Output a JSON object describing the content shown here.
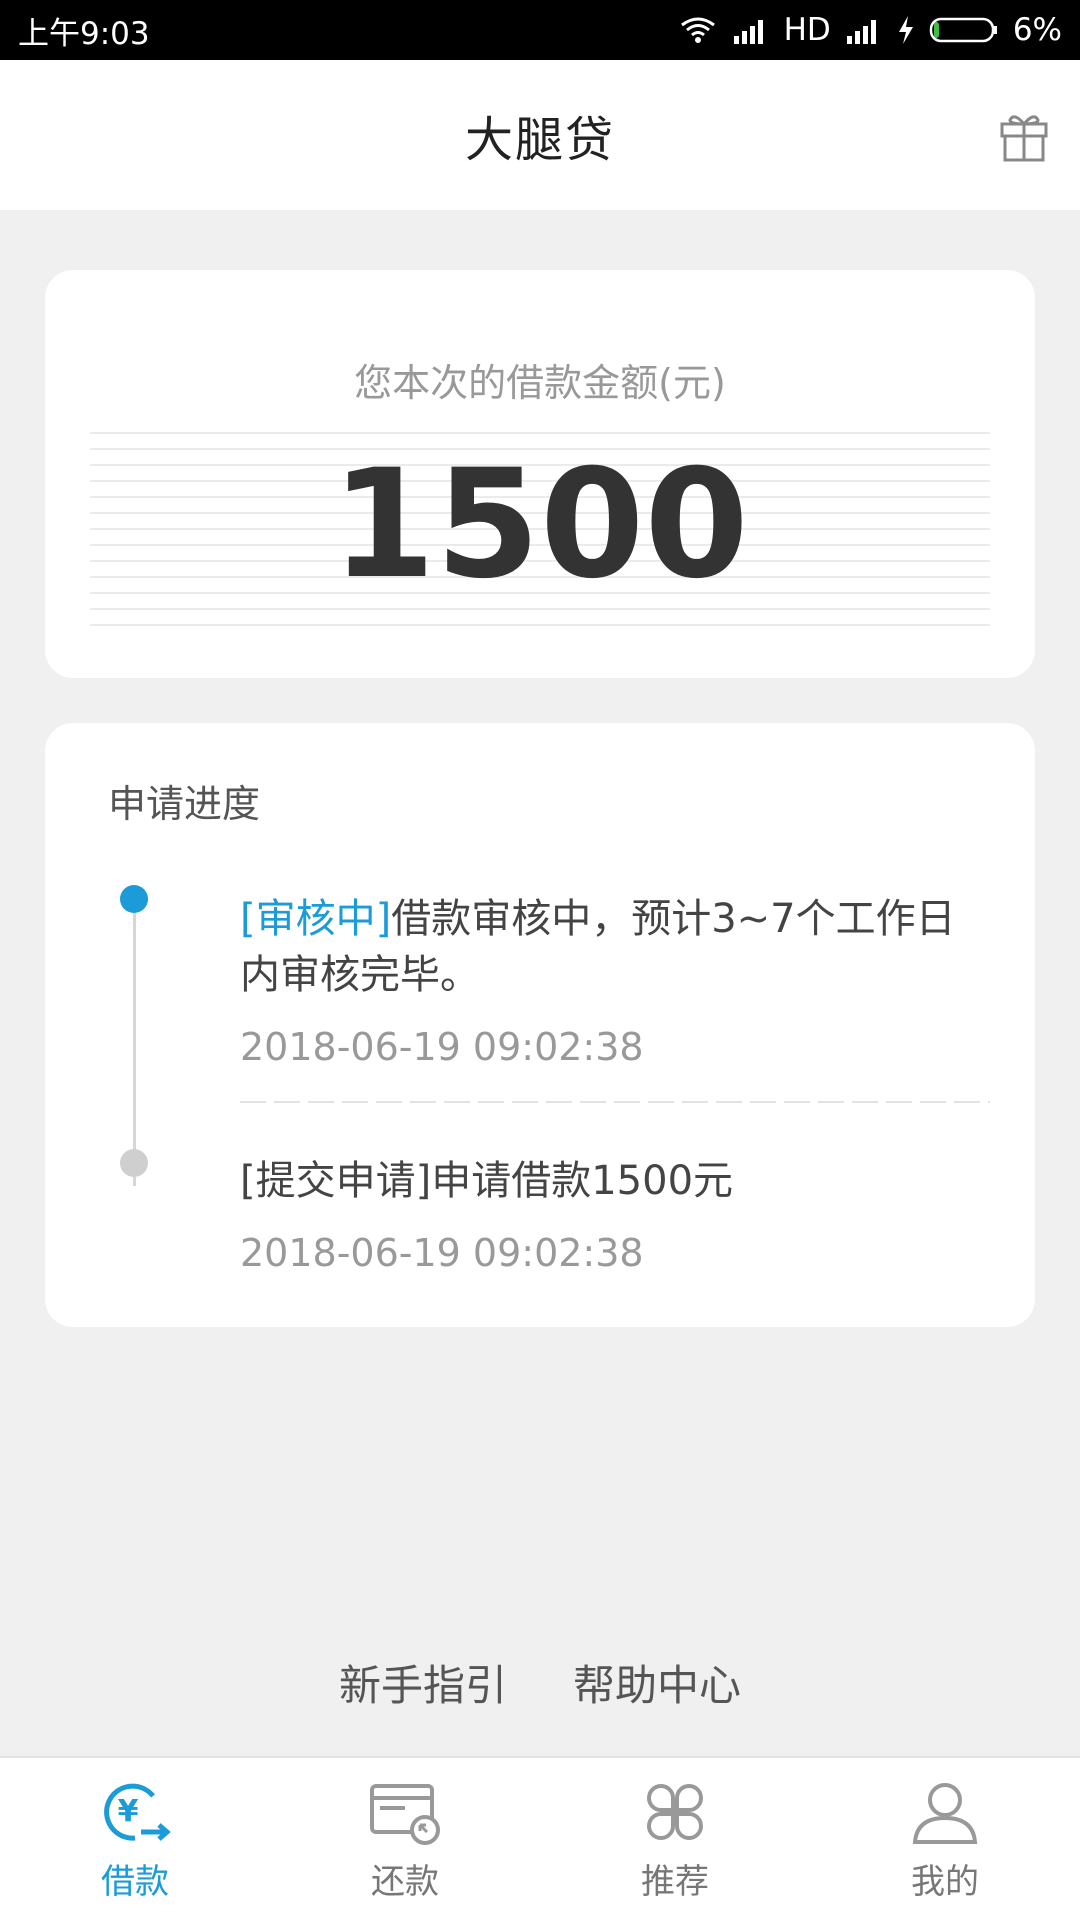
{
  "status_bar": {
    "time": "上午9:03",
    "network": "HD",
    "battery": "6%"
  },
  "app_bar": {
    "title": "大腿贷",
    "gift_icon": "gift-icon"
  },
  "amount_card": {
    "label": "您本次的借款金额(元)",
    "amount": "1500"
  },
  "progress": {
    "title": "申请进度",
    "items": [
      {
        "tag": "[审核中]",
        "text": "借款审核中，预计3~7个工作日内审核完毕。",
        "time": "2018-06-19 09:02:38",
        "active": true
      },
      {
        "tag": "[提交申请]",
        "text": "申请借款1500元",
        "time": "2018-06-19 09:02:38",
        "active": false
      }
    ]
  },
  "links": {
    "guide": "新手指引",
    "help": "帮助中心"
  },
  "bottom_nav": {
    "items": [
      {
        "label": "借款",
        "icon": "loan-icon",
        "active": true
      },
      {
        "label": "还款",
        "icon": "repay-icon",
        "active": false
      },
      {
        "label": "推荐",
        "icon": "recommend-icon",
        "active": false
      },
      {
        "label": "我的",
        "icon": "profile-icon",
        "active": false
      }
    ]
  },
  "colors": {
    "accent": "#1b9bd7",
    "background": "#f0f0f0"
  }
}
